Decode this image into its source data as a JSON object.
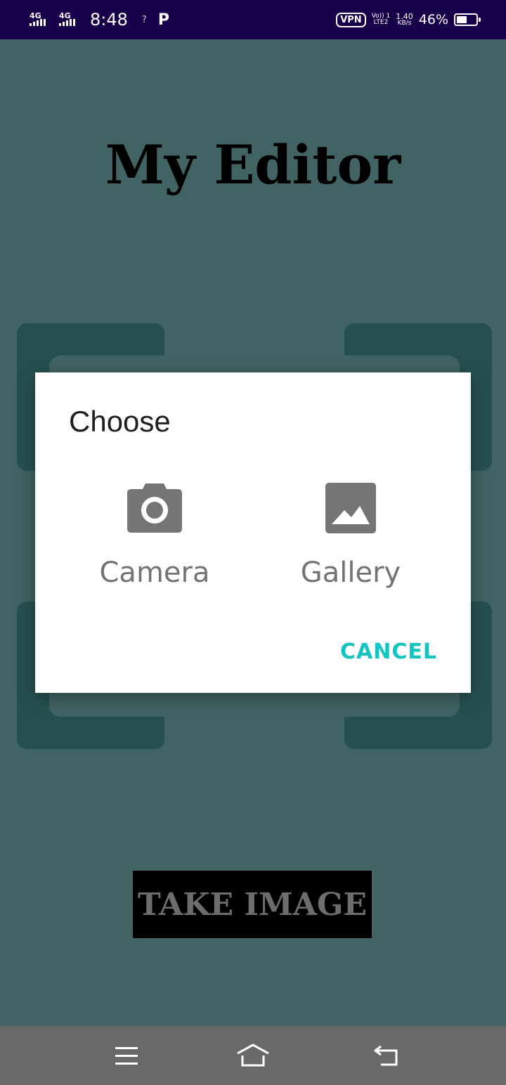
{
  "status_bar": {
    "net1": "4G",
    "net2": "4G",
    "time": "8:48",
    "signal_q": "?",
    "app_icon": "P",
    "vpn": "VPN",
    "volte_top": "Vo)) 1",
    "volte_bottom": "LTE2",
    "speed_top": "1.40",
    "speed_bottom": "KB/s",
    "battery_pct": "46%",
    "battery_level": 0.46
  },
  "app": {
    "title": "My Editor",
    "take_image_label": "TAKE IMAGE"
  },
  "dialog": {
    "title": "Choose",
    "options": [
      {
        "label": "Camera",
        "icon": "camera-icon"
      },
      {
        "label": "Gallery",
        "icon": "image-icon"
      }
    ],
    "cancel_label": "CANCEL",
    "accent": "#13c5c0"
  },
  "nav_bar": {
    "buttons": [
      "menu-icon",
      "home-icon",
      "back-icon"
    ]
  },
  "colors": {
    "background": "#416363",
    "frame": "#265050",
    "status_bar": "#16004a",
    "nav_bar": "#696969"
  }
}
